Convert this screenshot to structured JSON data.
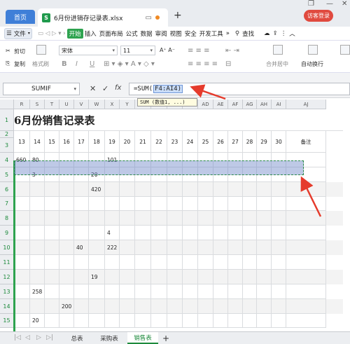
{
  "titlebar": {
    "home_tab": "首页",
    "doc_tab": "6月份进销存记录表.xlsx",
    "xls_glyph": "S",
    "new_tab": "+",
    "login": "访客登录",
    "win_controls": [
      "❐",
      "—",
      "✕"
    ]
  },
  "menu": {
    "file": "文件",
    "items": [
      "开始",
      "插入",
      "页面布局",
      "公式",
      "数据",
      "审阅",
      "视图",
      "安全",
      "开发工具"
    ],
    "active": "开始",
    "search": "查找"
  },
  "ribbon": {
    "cut": "剪切",
    "copy": "复制",
    "format_painter": "格式刷",
    "font": "宋体",
    "font_size": "11",
    "merge": "合并居中",
    "wrap": "自动换行",
    "bold": "B",
    "italic": "I",
    "underline": "U"
  },
  "formula_bar": {
    "name_box": "SUMIF",
    "cancel": "✕",
    "confirm": "✓",
    "fx": "fx",
    "formula_prefix": "=SUM(",
    "formula_ref": "F4:AI4)",
    "tooltip": "SUM (数值1, ...)"
  },
  "sheet": {
    "columns": [
      "R",
      "S",
      "T",
      "U",
      "V",
      "W",
      "X",
      "Y",
      "Z",
      "AA",
      "AB",
      "AC",
      "AD",
      "AE",
      "AF",
      "AG",
      "AH",
      "AI",
      "AJ"
    ],
    "rows": [
      "1",
      "2",
      "3",
      "4",
      "5",
      "6",
      "7",
      "8",
      "9",
      "10",
      "11",
      "12",
      "13",
      "14",
      "15"
    ],
    "title": "6月份销售记录表",
    "days": [
      "13",
      "14",
      "15",
      "16",
      "17",
      "18",
      "19",
      "20",
      "21",
      "22",
      "23",
      "24",
      "25",
      "26",
      "27",
      "28",
      "29",
      "30"
    ],
    "remark": "备注",
    "row4": [
      "660",
      "80",
      "",
      "",
      "",
      "",
      "101"
    ],
    "row5": [
      "",
      "3",
      "",
      "",
      "",
      "20"
    ],
    "row6": [
      "",
      "",
      "",
      "",
      "",
      "420"
    ],
    "row9": [
      "",
      "",
      "",
      "",
      "",
      "",
      "4"
    ],
    "row10": [
      "",
      "",
      "",
      "",
      "40",
      "",
      "222"
    ],
    "row12": [
      "",
      "",
      "",
      "",
      "",
      "19"
    ],
    "row13": [
      "",
      "258"
    ],
    "row14": [
      "",
      "",
      "",
      "200"
    ],
    "row15": [
      "",
      "20"
    ]
  },
  "sheet_tabs": [
    "总表",
    "采购表",
    "销售表"
  ],
  "active_sheet": "销售表",
  "add_sheet": "+",
  "colors": {
    "accent_green": "#2ea34f",
    "home_blue": "#3f7fd8",
    "selection": "#6e87c8",
    "arrow_red": "#e53b2c"
  }
}
